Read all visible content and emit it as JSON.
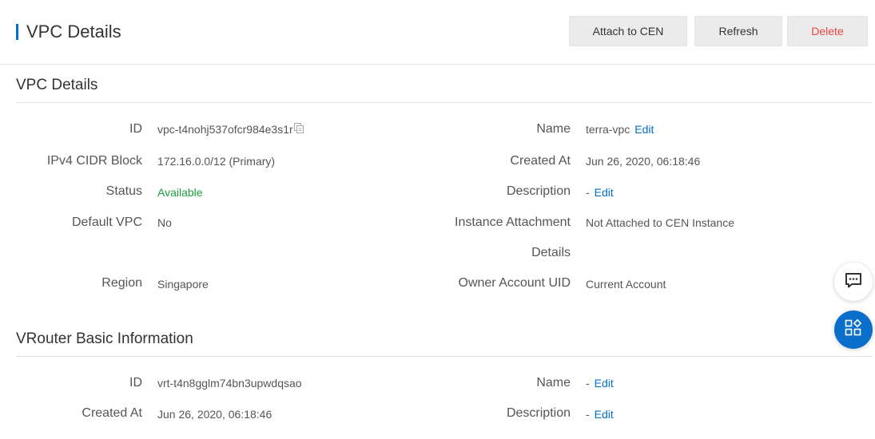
{
  "header": {
    "title": "VPC Details",
    "buttons": {
      "attach": "Attach to CEN",
      "refresh": "Refresh",
      "delete": "Delete"
    }
  },
  "vpc_section": {
    "title": "VPC Details",
    "fields": {
      "id_label": "ID",
      "id_value": "vpc-t4nohj537ofcr984e3s1r",
      "name_label": "Name",
      "name_value": "terra-vpc",
      "name_edit": "Edit",
      "cidr_label": "IPv4 CIDR Block",
      "cidr_value": "172.16.0.0/12 (Primary)",
      "created_label": "Created At",
      "created_value": "Jun 26, 2020, 06:18:46",
      "status_label": "Status",
      "status_value": "Available",
      "description_label": "Description",
      "description_value": "-",
      "description_edit": "Edit",
      "default_vpc_label": "Default VPC",
      "default_vpc_value": "No",
      "attachment_label_line1": "Instance Attachment",
      "attachment_label_line2": "Details",
      "attachment_value": "Not Attached to CEN Instance",
      "region_label": "Region",
      "region_value": "Singapore",
      "owner_label": "Owner Account UID",
      "owner_value": "Current Account"
    }
  },
  "vrouter_section": {
    "title": "VRouter Basic Information",
    "fields": {
      "id_label": "ID",
      "id_value": "vrt-t4n8gglm74bn3upwdqsao",
      "name_label": "Name",
      "name_value": "-",
      "name_edit": "Edit",
      "created_label": "Created At",
      "created_value": "Jun 26, 2020, 06:18:46",
      "description_label": "Description",
      "description_value": "-",
      "description_edit": "Edit"
    }
  },
  "colors": {
    "accent": "#0070cc",
    "status_available": "#1e9e3e",
    "delete": "#e84444"
  },
  "icons": [
    "copy-icon",
    "chat-icon",
    "apps-icon"
  ]
}
